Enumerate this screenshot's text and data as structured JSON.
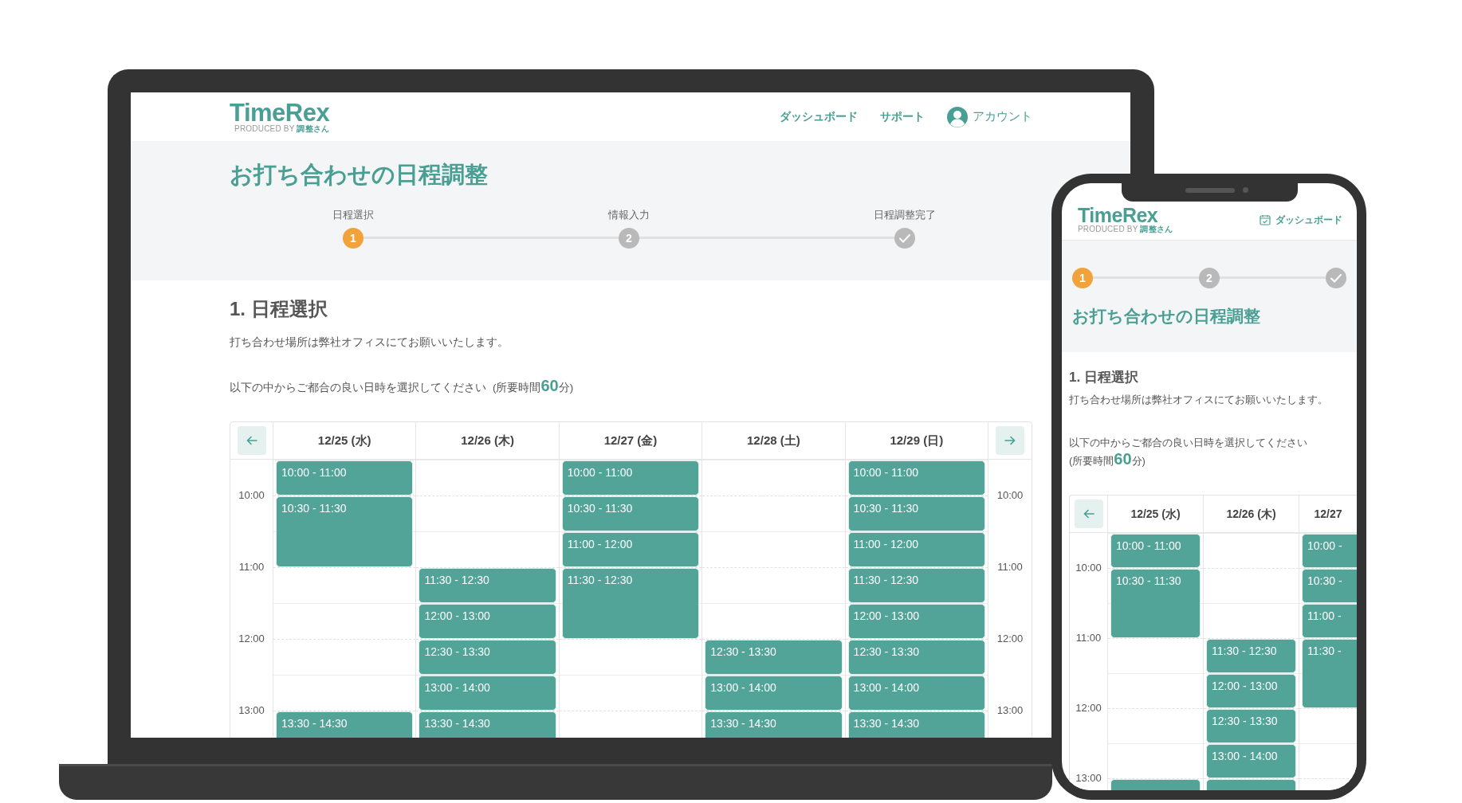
{
  "laptop": {
    "header": {
      "logo": "TimeRex",
      "tagline": "PRODUCED BY **調整さん**",
      "nav": [
        {
          "kind": "link",
          "label": "ダッシュボード"
        },
        {
          "kind": "link",
          "label": "サポート"
        },
        {
          "kind": "account",
          "label": "アカウント"
        }
      ]
    },
    "title": "お打ち合わせの日程調整",
    "steps": [
      {
        "label": "日程選択",
        "marker": "1",
        "kind": "number",
        "current": true
      },
      {
        "label": "情報入力",
        "marker": "2",
        "kind": "number",
        "current": false
      },
      {
        "label": "日程調整完了",
        "kind": "check",
        "current": false
      }
    ],
    "section_heading": "1. 日程選択",
    "note": "打ち合わせ場所は弊社オフィスにてお願いいたします。",
    "instruction": "以下の中からご都合の良い日時を選択してください",
    "duration": "(所要時間**60**分)",
    "calendar": {
      "has_prev": true,
      "has_next": true,
      "hours": [
        "10:00",
        "11:00",
        "12:00",
        "13:00"
      ],
      "hours_right": [
        "10:00",
        "11:00",
        "12:00",
        "13:00"
      ],
      "days": [
        {
          "label": "12/25 (水)",
          "slots": [
            {
              "available": true,
              "label": "10:00 - 11:00"
            },
            {
              "available": true,
              "label": "10:30 - 11:30"
            },
            {
              "available": false
            },
            {
              "available": false
            },
            {
              "available": false
            },
            {
              "available": false
            },
            {
              "available": false
            },
            {
              "available": true,
              "label": "13:30 - 14:30"
            }
          ]
        },
        {
          "label": "12/26 (木)",
          "slots": [
            {
              "available": false
            },
            {
              "available": false
            },
            {
              "available": false
            },
            {
              "available": true,
              "label": "11:30 - 12:30"
            },
            {
              "available": true,
              "label": "12:00 - 13:00"
            },
            {
              "available": true,
              "label": "12:30 - 13:30"
            },
            {
              "available": true,
              "label": "13:00 - 14:00"
            },
            {
              "available": true,
              "label": "13:30 - 14:30"
            }
          ]
        },
        {
          "label": "12/27 (金)",
          "slots": [
            {
              "available": true,
              "label": "10:00 - 11:00"
            },
            {
              "available": true,
              "label": "10:30 - 11:30"
            },
            {
              "available": true,
              "label": "11:00 - 12:00"
            },
            {
              "available": true,
              "label": "11:30 - 12:30"
            },
            {
              "available": false
            },
            {
              "available": false
            },
            {
              "available": false
            },
            {
              "available": false
            }
          ]
        },
        {
          "label": "12/28 (土)",
          "slots": [
            {
              "available": false
            },
            {
              "available": false
            },
            {
              "available": false
            },
            {
              "available": false
            },
            {
              "available": false
            },
            {
              "available": true,
              "label": "12:30 - 13:30"
            },
            {
              "available": true,
              "label": "13:00 - 14:00"
            },
            {
              "available": true,
              "label": "13:30 - 14:30"
            }
          ]
        },
        {
          "label": "12/29 (日)",
          "slots": [
            {
              "available": true,
              "label": "10:00 - 11:00"
            },
            {
              "available": true,
              "label": "10:30 - 11:30"
            },
            {
              "available": true,
              "label": "11:00 - 12:00"
            },
            {
              "available": true,
              "label": "11:30 - 12:30"
            },
            {
              "available": true,
              "label": "12:00 - 13:00"
            },
            {
              "available": true,
              "label": "12:30 - 13:30"
            },
            {
              "available": true,
              "label": "13:00 - 14:00"
            },
            {
              "available": true,
              "label": "13:30 - 14:30"
            }
          ]
        }
      ]
    }
  },
  "phone": {
    "header": {
      "logo": "TimeRex",
      "tagline": "PRODUCED BY **調整さん**",
      "nav": [
        {
          "kind": "calendar",
          "label": "ダッシュボード"
        }
      ]
    },
    "steps": [
      {
        "marker": "1",
        "kind": "number",
        "current": true
      },
      {
        "marker": "2",
        "kind": "number",
        "current": false
      },
      {
        "kind": "check",
        "current": false
      }
    ],
    "title": "お打ち合わせの日程調整",
    "section_heading": "1. 日程選択",
    "note": "打ち合わせ場所は弊社オフィスにてお願いいたします。",
    "instruction": "以下の中からご都合の良い日時を選択してください",
    "duration": "(所要時間**60**分)",
    "calendar": {
      "has_prev": true,
      "hours": [
        "10:00",
        "11:00",
        "12:00",
        "13:00"
      ],
      "days": [
        {
          "label": "12/25 (水)",
          "slots": [
            {
              "available": true,
              "label": "10:00 - 11:00"
            },
            {
              "available": true,
              "label": "10:30 - 11:30"
            },
            {
              "available": false
            },
            {
              "available": false
            },
            {
              "available": false
            },
            {
              "available": false
            },
            {
              "available": false
            },
            {
              "available": true
            }
          ]
        },
        {
          "label": "12/26 (木)",
          "slots": [
            {
              "available": false
            },
            {
              "available": false
            },
            {
              "available": false
            },
            {
              "available": true,
              "label": "11:30 - 12:30"
            },
            {
              "available": true,
              "label": "12:00 - 13:00"
            },
            {
              "available": true,
              "label": "12:30 - 13:30"
            },
            {
              "available": true,
              "label": "13:00 - 14:00"
            },
            {
              "available": true
            }
          ]
        },
        {
          "label": "12/27",
          "slots": [
            {
              "available": true,
              "label": "10:00 -"
            },
            {
              "available": true,
              "label": "10:30 -"
            },
            {
              "available": true,
              "label": "11:00 -"
            },
            {
              "available": true,
              "label": "11:30 -"
            },
            {
              "available": false
            },
            {
              "available": false
            },
            {
              "available": false
            },
            {
              "available": false
            }
          ]
        }
      ]
    }
  }
}
